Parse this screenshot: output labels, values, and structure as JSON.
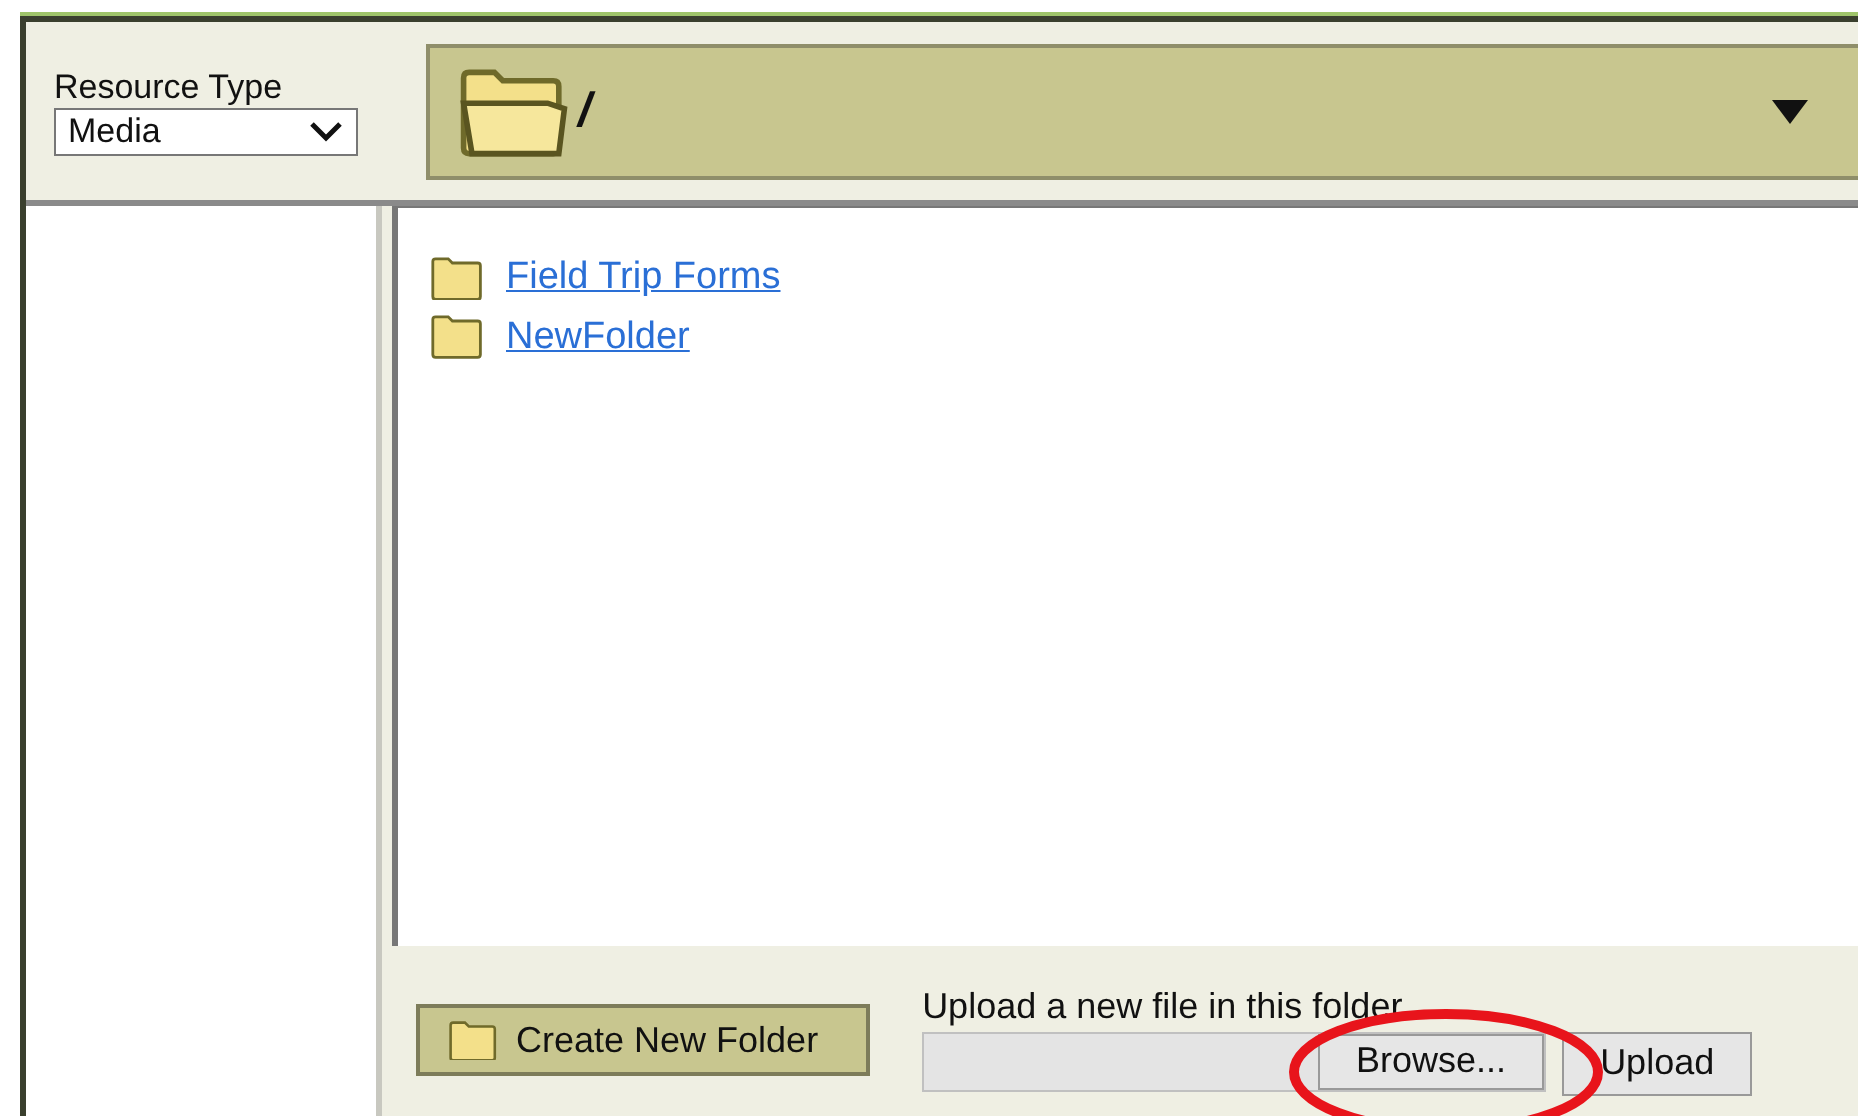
{
  "resource_type": {
    "label": "Resource Type",
    "value": "Media"
  },
  "path_bar": {
    "path": "/"
  },
  "folders": [
    {
      "name": "Field Trip Forms"
    },
    {
      "name": "NewFolder"
    }
  ],
  "create_folder_button": "Create New Folder",
  "upload": {
    "label": "Upload a new file in this folder",
    "browse_button": "Browse...",
    "upload_button": "Upload"
  },
  "annotation": {
    "kind": "ellipse",
    "color": "#e8141b"
  }
}
